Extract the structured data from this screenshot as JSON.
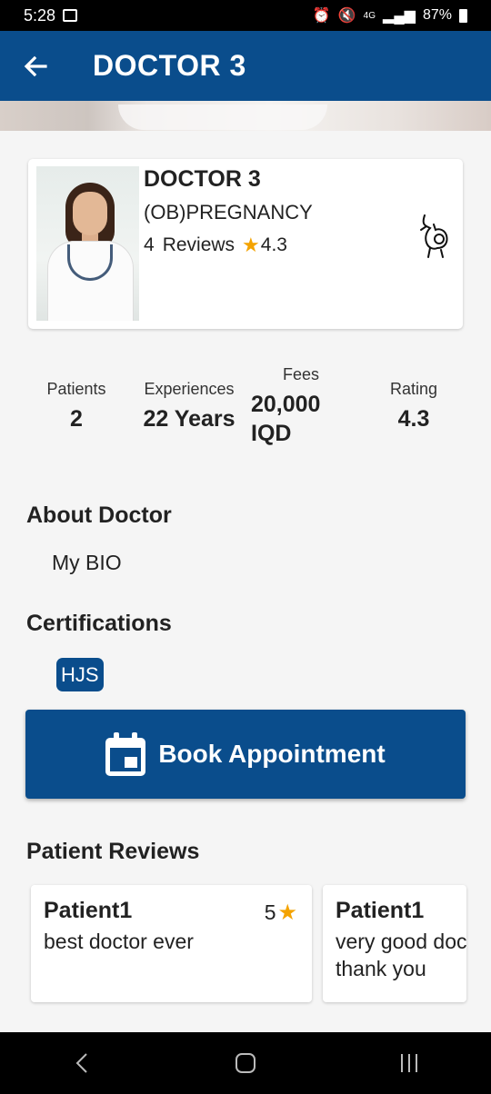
{
  "status_bar": {
    "time": "5:28",
    "network": "4G",
    "battery": "87%"
  },
  "app_bar": {
    "title": "DOCTOR 3"
  },
  "doctor": {
    "name": "DOCTOR 3",
    "specialty": "(OB)PREGNANCY",
    "reviews_count": "4",
    "reviews_label": "Reviews",
    "rating": "4.3"
  },
  "stats": {
    "patients": {
      "label": "Patients",
      "value": "2"
    },
    "experiences": {
      "label": "Experiences",
      "value": "22 Years"
    },
    "fees": {
      "label": "Fees",
      "value_line1": "20,000",
      "value_line2": "IQD"
    },
    "rating": {
      "label": "Rating",
      "value": "4.3"
    }
  },
  "about": {
    "title": "About Doctor",
    "bio": "My BIO"
  },
  "certifications": {
    "title": "Certifications",
    "items": [
      "HJS"
    ]
  },
  "book_button": {
    "label": "Book Appointment"
  },
  "reviews": {
    "title": "Patient Reviews",
    "items": [
      {
        "patient": "Patient1",
        "text": "best doctor ever",
        "rating": "5"
      },
      {
        "patient": "Patient1",
        "text": "very good doctor thank you",
        "rating": ""
      }
    ]
  },
  "colors": {
    "primary": "#0a4d8c",
    "star": "#f4a300",
    "background": "#f5f5f5"
  },
  "icons": {
    "back": "arrow-left-icon",
    "specialty": "pregnancy-icon",
    "book": "calendar-icon",
    "star": "star-icon"
  }
}
